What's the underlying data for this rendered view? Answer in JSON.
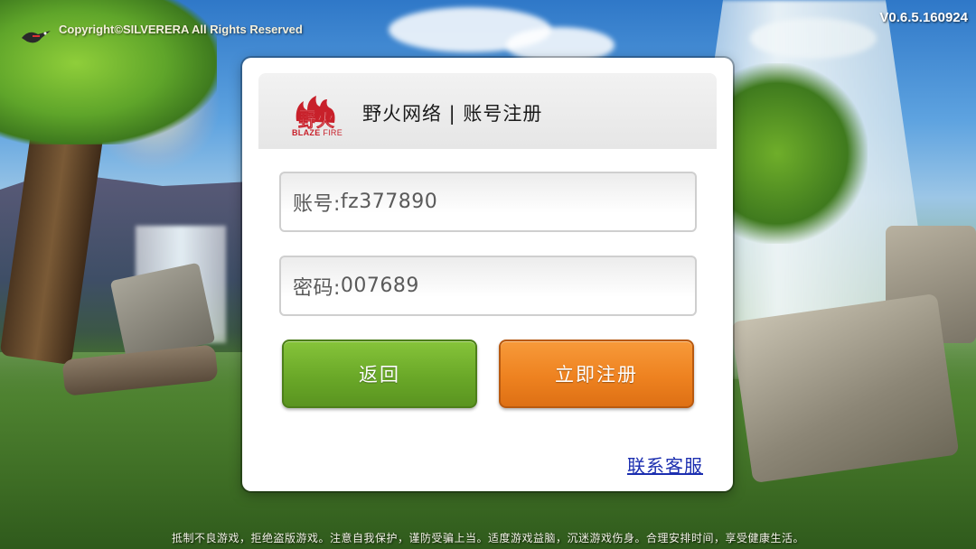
{
  "game": {
    "copyright": "Copyright©SILVERERA All Rights Reserved",
    "version": "V0.6.5.160924",
    "footer_notice": "抵制不良游戏，拒绝盗版游戏。注意自我保护，谨防受骗上当。适度游戏益脑，沉迷游戏伤身。合理安排时间，享受健康生活。"
  },
  "dialog": {
    "logo": {
      "icon": "blaze-fire-logo-icon",
      "glyph": "野火",
      "brand_primary": "BLAZE",
      "brand_secondary": "FIRE",
      "color": "#c8202a"
    },
    "title": "野火网络 | 账号注册",
    "account_field": {
      "label": "账号:",
      "value": "fz377890"
    },
    "password_field": {
      "label": "密码:",
      "value": "007689"
    },
    "back_button": {
      "label": "返回",
      "color": "#6aa828"
    },
    "register_button": {
      "label": "立即注册",
      "color": "#ee8220"
    },
    "customer_service_link": "联系客服"
  }
}
